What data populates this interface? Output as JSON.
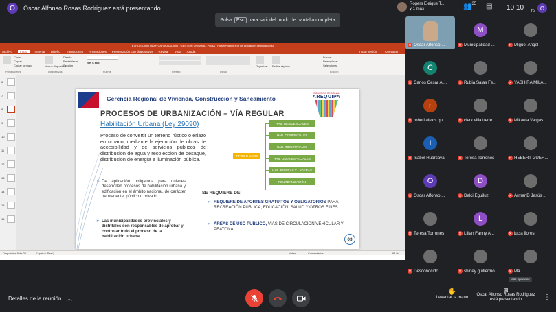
{
  "topbar": {
    "presenter_initial": "O",
    "presenter_label": "Oscar Alfonso Rosas Rodriguez está presentando",
    "esc_prefix": "Pulsa",
    "esc_key": "Esc",
    "esc_suffix": "para salir del modo de pantalla completa",
    "raised_user_line1": "Rogers Eleique T...",
    "raised_user_line2": "y 1 más",
    "participant_count": "35",
    "clock": "10:10",
    "self_initial": "O",
    "self_label": "Tú"
  },
  "powerpoint": {
    "window_title": "EXPOSICION OLAF CAPACITACION - GESTION URBANA - PMAA - PowerPoint (Error de activación de productos)",
    "tabs": [
      "Archivo",
      "Inicio",
      "Insertar",
      "Diseño",
      "Transiciones",
      "Animaciones",
      "Presentación con diapositivas",
      "Revisar",
      "Vista",
      "Ayuda"
    ],
    "right_tabs": [
      "Iniciar sesión",
      "Compartir"
    ],
    "ribbon_groups": [
      "Portapapeles",
      "Diapositivas",
      "Fuente",
      "Párrafo",
      "Dibujo",
      "Edición"
    ],
    "ribbon_buttons": [
      "Cortar",
      "Copiar",
      "Copiar formato",
      "Nueva diapositiva",
      "Diseño",
      "Restablecer",
      "Sección",
      "Organizar",
      "Estilos rápidos",
      "Buscar",
      "Reemplazar",
      "Seleccionar"
    ],
    "thumb_numbers": [
      "6",
      "7",
      "8",
      "9",
      "10",
      "11",
      "12",
      "13",
      "14",
      "15",
      "16"
    ],
    "status_slide": "Diapositiva 8 de 28",
    "status_lang": "Español (Perú)",
    "status_notes": "Notas",
    "status_comments": "Comentarios",
    "zoom": "84 %"
  },
  "slide": {
    "header": "Gerencia Regional de Vivienda, Construcción y Saneamiento",
    "gov_small": "GOBIERNO REGIONAL",
    "gov_big": "AREQUIPA",
    "title": "PROCESOS DE URBANIZACIÓN – VÍA REGULAR",
    "subtitle": "Habilitación Urbana (Ley 29090)",
    "paragraph": "Proceso de convertir un terreno rústico o eriazo en urbano, mediante la ejecución de obras de accesibilidad y de servicios públicos de distribución de agua y recolección de desagüe, distribución de energía e iluminación pública.",
    "bullet1": "De aplicación obligatoria para quienes desarrollen procesos de habilitación urbana y edificación en el ámbito nacional, de carácter permanente, público o privado.",
    "bullet2": "Las municipalidades provinciales y distritales son responsables de aprobar y controlar todo el proceso de la habilitación urbana",
    "tipos_label": "TIPOS O USOS",
    "hab_types": [
      "HAB. RESIDENCIALES",
      "HAB. COMERCIALES",
      "HAB. INDUSTRIALES",
      "HAB. USOS ESPECIALES",
      "HAB. RIBERAS Y LADERAS",
      "REURBANIZACIÓN"
    ],
    "se_requiere": "SE REQUIERE DE:",
    "req1_bold": "REQUIERE DE APORTES GRATUITOS Y OBLIGATORIOS",
    "req1_rest": " PARA RECREACIÓN PÚBLICA, EDUCACIÓN, SALUD Y OTROS FINES.",
    "req2_bold": "ÁREAS DE USO PÚBLICO,",
    "req2_rest": " VÍAS DE CIRCULACIÓN VEHICULAR Y PEATONAL.",
    "page_number": "03"
  },
  "participants": [
    {
      "name": "Oscar Alfonso ...",
      "initial": "",
      "color": "#7d9fb1",
      "video": true
    },
    {
      "name": "Municipalidad ...",
      "initial": "M",
      "color": "#8e4fc4",
      "video": false
    },
    {
      "name": "Miguel Angel",
      "initial": "",
      "color": "#6d6d6d",
      "video": false
    },
    {
      "name": "Carlos Cesar Al...",
      "initial": "C",
      "color": "#12836f",
      "video": false
    },
    {
      "name": "Rubia Salas Fe...",
      "initial": "",
      "color": "#6d6d6d",
      "video": false
    },
    {
      "name": "YASHIRA MILA...",
      "initial": "",
      "color": "#6d6d6d",
      "video": false
    },
    {
      "name": "roberi alexis qu...",
      "initial": "r",
      "color": "#b7410e",
      "video": false
    },
    {
      "name": "clerk villafuerte...",
      "initial": "",
      "color": "#6d6d6d",
      "video": false
    },
    {
      "name": "Mikaela Vargas...",
      "initial": "",
      "color": "#6d6d6d",
      "video": false
    },
    {
      "name": "Isabel Huarcaya",
      "initial": "I",
      "color": "#1a5fb4",
      "video": false
    },
    {
      "name": "Teresa Torrones",
      "initial": "",
      "color": "#6d6d6d",
      "video": false
    },
    {
      "name": "HEBERT GUER...",
      "initial": "",
      "color": "#6d6d6d",
      "video": false
    },
    {
      "name": "Oscar Alfonso ...",
      "initial": "O",
      "color": "#5c3bb5",
      "video": false
    },
    {
      "name": "Dalci Eguiluz",
      "initial": "D",
      "color": "#8e4fc4",
      "video": false
    },
    {
      "name": "ArmanD Jesús ...",
      "initial": "",
      "color": "#6d6d6d",
      "video": false
    },
    {
      "name": "Teresa Torrones",
      "initial": "",
      "color": "#6d6d6d",
      "video": false
    },
    {
      "name": "Lilian Fanny A...",
      "initial": "L",
      "color": "#8e4fc4",
      "video": false
    },
    {
      "name": "lucia flores",
      "initial": "",
      "color": "#6d6d6d",
      "video": false
    },
    {
      "name": "Desconocido",
      "initial": "",
      "color": "#6d6d6d",
      "video": false
    },
    {
      "name": "shirley guillermo",
      "initial": "",
      "color": "#6d6d6d",
      "video": false
    },
    {
      "name": "Ma...",
      "initial": "",
      "color": "#6d6d6d",
      "video": false
    }
  ],
  "more_options": "Más opciones",
  "bottom": {
    "details_label": "Detalles de la reunión",
    "raise_hand_label": "Levantar la mano",
    "presenting_line1": "Oscar Alfonso Rosas Rodriguez",
    "presenting_line2": "está presentando"
  },
  "colors": {
    "background": "#202124",
    "ppt_red": "#c43e1c",
    "end_call_red": "#ea4335",
    "slide_blue": "#1f3c7a",
    "hab_green": "#7aaa45",
    "tipos_yellow": "#f5b400"
  },
  "icons": [
    "presenter-avatar-icon",
    "people-icon",
    "chat-icon",
    "activities-icon",
    "mic-off-icon",
    "end-call-icon",
    "camera-icon",
    "raise-hand-icon",
    "present-icon",
    "more-vert-icon",
    "chevron-up-icon"
  ]
}
